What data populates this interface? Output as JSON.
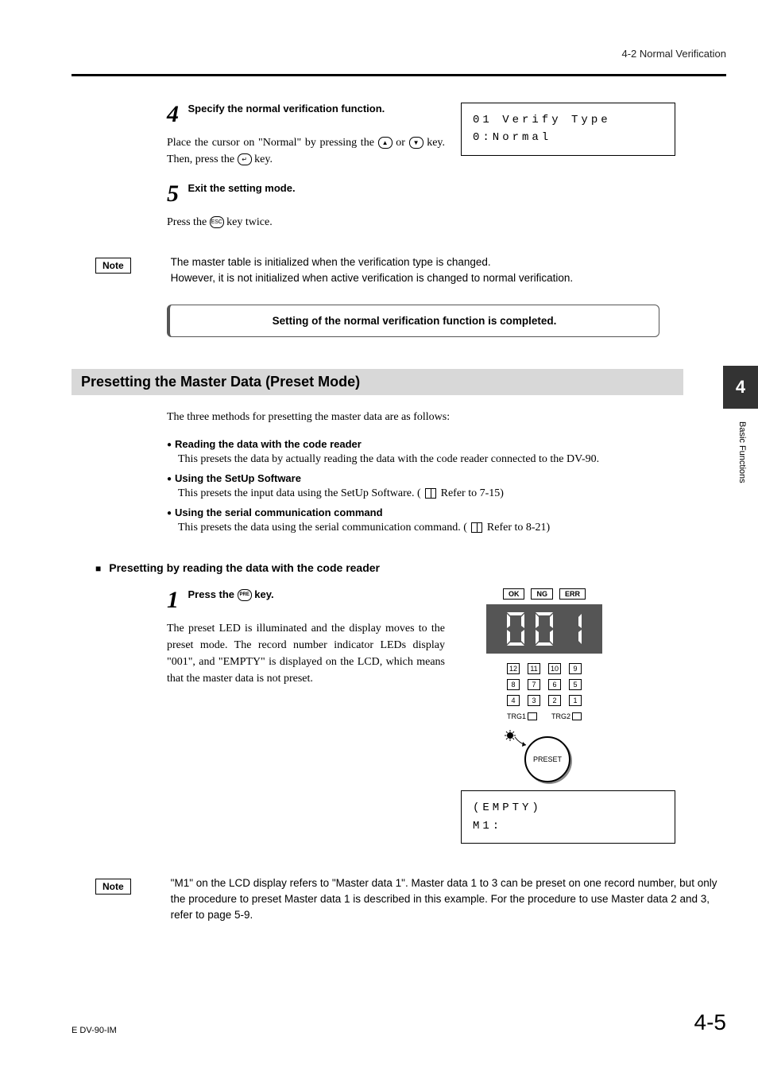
{
  "header": {
    "section_ref": "4-2  Normal Verification"
  },
  "steps": {
    "s4": {
      "title": "Specify the normal verification function.",
      "body_pre": "Place the cursor on \"Normal\" by pressing the ",
      "body_mid": " or ",
      "body_mid2": " key. Then, press the ",
      "body_post": " key.",
      "lcd_line1": "01 Verify Type",
      "lcd_line2": "0:Normal"
    },
    "s5": {
      "title": "Exit the setting mode.",
      "body_pre": "Press the ",
      "body_post": " key twice."
    }
  },
  "note1": {
    "label": "Note",
    "text": "The master table is initialized when the verification type is changed.\nHowever, it is not initialized when active verification is changed to normal verification."
  },
  "completion": "Setting of the normal verification function is completed.",
  "section": {
    "title": "Presetting the Master Data (Preset Mode)",
    "intro": "The three methods for presetting the master data are as follows:"
  },
  "bullets": {
    "b1": {
      "head": "Reading the data with the code reader",
      "body": "This presets the data by actually reading the data with the code reader connected to the DV-90."
    },
    "b2": {
      "head": "Using the SetUp Software",
      "body_pre": "This presets the input data using the SetUp Software. ( ",
      "ref": " Refer to 7-15)"
    },
    "b3": {
      "head": "Using the serial communication command",
      "body_pre": "This presets the data using the serial communication command. ( ",
      "ref": " Refer to 8-21)"
    }
  },
  "subhead": "Presetting by reading the data with the code reader",
  "step1": {
    "title_pre": "Press the ",
    "title_post": " key.",
    "body": "The preset LED is illuminated and the display moves to the preset mode. The record number indicator LEDs display \"001\", and \"EMPTY\" is displayed on the LCD, which means that the master data is not preset."
  },
  "device": {
    "leds": [
      "OK",
      "NG",
      "ERR"
    ],
    "grid": [
      [
        "12",
        "11",
        "10",
        "9"
      ],
      [
        "8",
        "7",
        "6",
        "5"
      ],
      [
        "4",
        "3",
        "2",
        "1"
      ]
    ],
    "trg1": "TRG1",
    "trg2": "TRG2",
    "preset": "PRESET",
    "lcd_line1": "(EMPTY)",
    "lcd_line2": "M1:"
  },
  "note2": {
    "label": "Note",
    "text": "\"M1\" on the LCD display refers to \"Master data 1\". Master data 1 to 3 can be preset on one record number, but only the procedure to preset Master data 1 is described in this example. For the procedure to use Master data 2 and 3, refer to page 5-9."
  },
  "sidetab": {
    "num": "4",
    "label": "Basic Functions"
  },
  "footer": {
    "left": "E DV-90-IM",
    "right": "4-5"
  }
}
